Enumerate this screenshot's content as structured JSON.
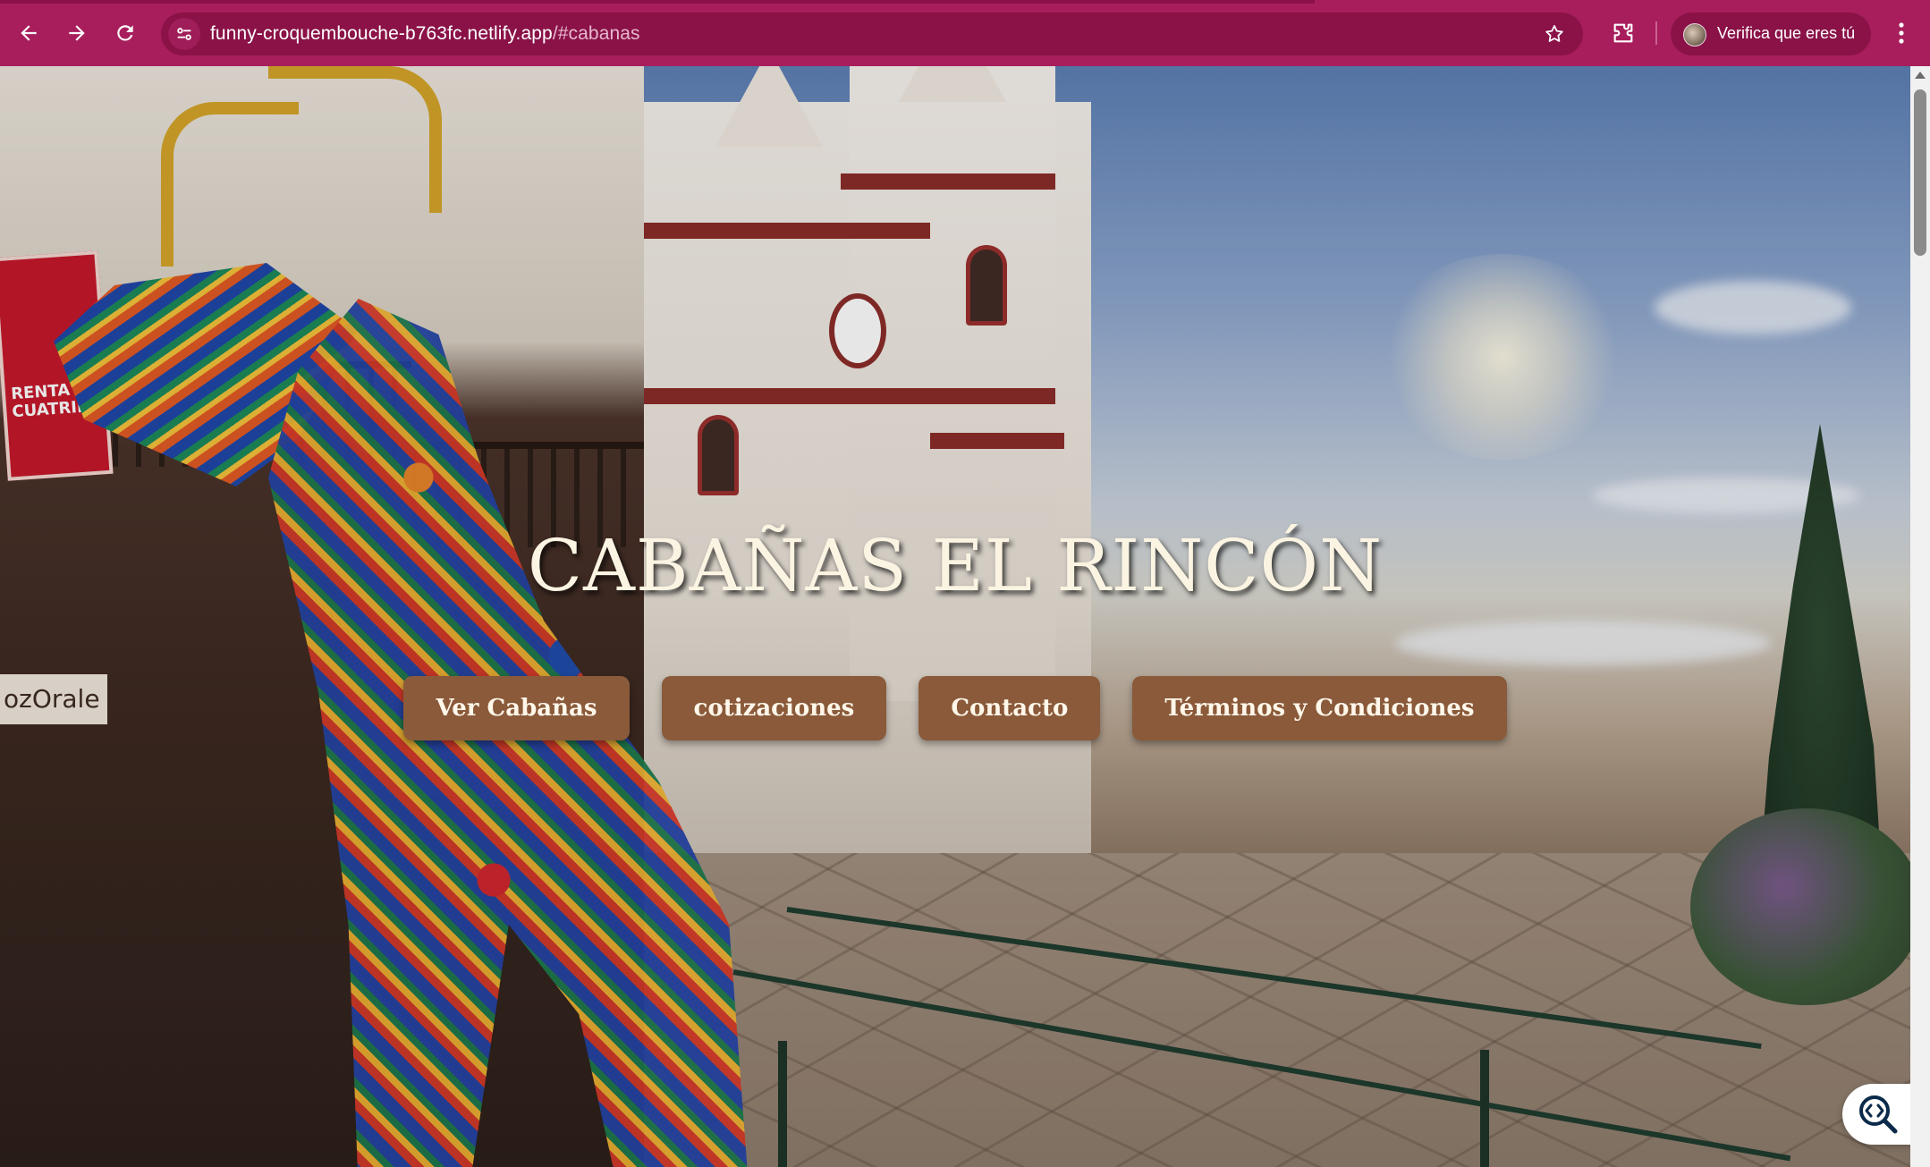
{
  "browser": {
    "url_host": "funny-croquembouche-b763fc.netlify.app",
    "url_path": "/#cabanas",
    "profile_label": "Verifica que eres tú",
    "accent_color": "#a81e5c"
  },
  "hero": {
    "title": "CABAÑAS EL RINCÓN",
    "nav": [
      {
        "label": "Ver Cabañas"
      },
      {
        "label": "cotizaciones"
      },
      {
        "label": "Contacto"
      },
      {
        "label": "Términos y Condiciones"
      }
    ],
    "button_color": "#8a5a3a"
  },
  "photo": {
    "sign_text": "RENTA DE CUATRIMOTOS",
    "storefront_text": "ozOrale"
  },
  "icons": [
    "back-icon",
    "forward-icon",
    "reload-icon",
    "site-info-icon",
    "bookmark-star-icon",
    "extensions-icon",
    "menu-dots-icon",
    "code-search-icon"
  ]
}
